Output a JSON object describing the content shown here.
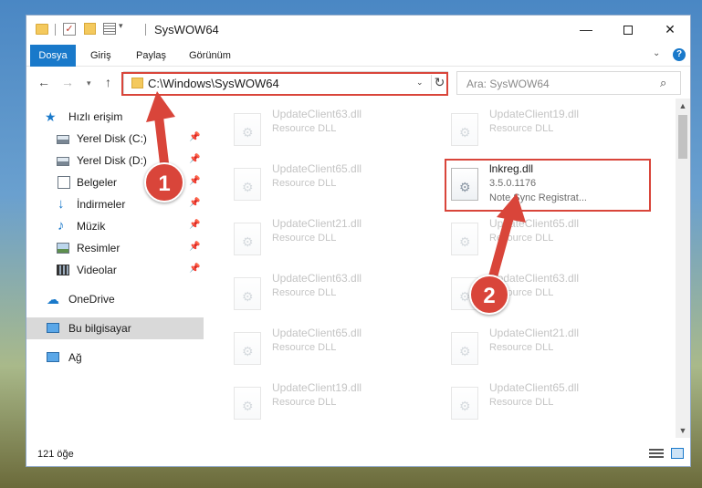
{
  "window": {
    "title": "SysWOW64",
    "buttons": {
      "minimize": "—",
      "maximize": "",
      "close": "✕"
    }
  },
  "ribbon": {
    "tabs": [
      {
        "label": "Dosya",
        "active": true
      },
      {
        "label": "Giriş",
        "active": false
      },
      {
        "label": "Paylaş",
        "active": false
      },
      {
        "label": "Görünüm",
        "active": false
      }
    ],
    "help": "?"
  },
  "address": {
    "path": "C:\\Windows\\SysWOW64",
    "search_placeholder": "Ara: SysWOW64"
  },
  "sidebar": {
    "items": [
      {
        "label": "Hızlı erişim",
        "icon": "star-icon",
        "pinned": false
      },
      {
        "label": "Yerel Disk (C:)",
        "icon": "disk-icon",
        "pinned": true
      },
      {
        "label": "Yerel Disk (D:)",
        "icon": "disk-icon",
        "pinned": true
      },
      {
        "label": "Belgeler",
        "icon": "document-icon",
        "pinned": true
      },
      {
        "label": "İndirmeler",
        "icon": "download-icon",
        "pinned": true
      },
      {
        "label": "Müzik",
        "icon": "music-icon",
        "pinned": true
      },
      {
        "label": "Resimler",
        "icon": "pictures-icon",
        "pinned": true
      },
      {
        "label": "Videolar",
        "icon": "video-icon",
        "pinned": true
      },
      {
        "label": "OneDrive",
        "icon": "cloud-icon",
        "pinned": false
      },
      {
        "label": "Bu bilgisayar",
        "icon": "computer-icon",
        "pinned": false,
        "selected": true
      },
      {
        "label": "Ağ",
        "icon": "network-icon",
        "pinned": false
      }
    ]
  },
  "files": [
    {
      "name": "UpdateClient63.dll",
      "version": "Resource DLL",
      "desc": "",
      "faded": true
    },
    {
      "name": "UpdateClient19.dll",
      "version": "Resource DLL",
      "desc": "",
      "faded": true
    },
    {
      "name": "UpdateClient65.dll",
      "version": "Resource DLL",
      "desc": "",
      "faded": true
    },
    {
      "name": "lnkreg.dll",
      "version": "3.5.0.1176",
      "desc": "Note Sync Registrat...",
      "faded": false
    },
    {
      "name": "UpdateClient21.dll",
      "version": "Resource DLL",
      "desc": "",
      "faded": true
    },
    {
      "name": "UpdateClient65.dll",
      "version": "Resource DLL",
      "desc": "",
      "faded": true
    },
    {
      "name": "UpdateClient63.dll",
      "version": "Resource DLL",
      "desc": "",
      "faded": true
    },
    {
      "name": "UpdateClient63.dll",
      "version": "Resource DLL",
      "desc": "",
      "faded": true
    },
    {
      "name": "UpdateClient65.dll",
      "version": "Resource DLL",
      "desc": "",
      "faded": true
    },
    {
      "name": "UpdateClient21.dll",
      "version": "Resource DLL",
      "desc": "",
      "faded": true
    },
    {
      "name": "UpdateClient19.dll",
      "version": "Resource DLL",
      "desc": "",
      "faded": true
    },
    {
      "name": "UpdateClient65.dll",
      "version": "Resource DLL",
      "desc": "",
      "faded": true
    }
  ],
  "status": {
    "count": "121 öğe"
  },
  "annotations": {
    "step1": "1",
    "step2": "2",
    "color": "#d9453a"
  }
}
